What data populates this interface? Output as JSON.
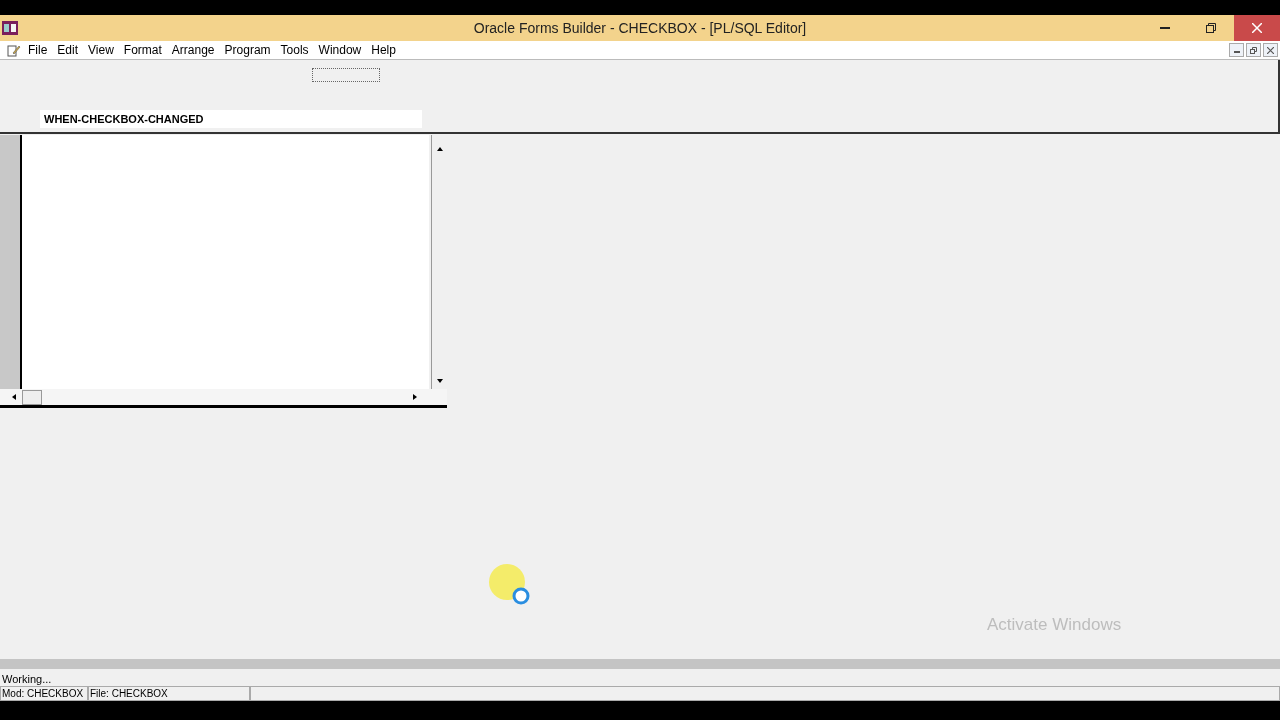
{
  "window": {
    "title": "Oracle Forms Builder - CHECKBOX - [PL/SQL Editor]"
  },
  "menu": [
    "File",
    "Edit",
    "View",
    "Format",
    "Arrange",
    "Program",
    "Tools",
    "Window",
    "Help"
  ],
  "trigger_name": "WHEN-CHECKBOX-CHANGED",
  "watermark_text": "Activate Windows",
  "status_bar": {
    "message": "Working...",
    "panels": [
      "Mod: CHECKBOX",
      "File: CHECKBOX"
    ]
  }
}
